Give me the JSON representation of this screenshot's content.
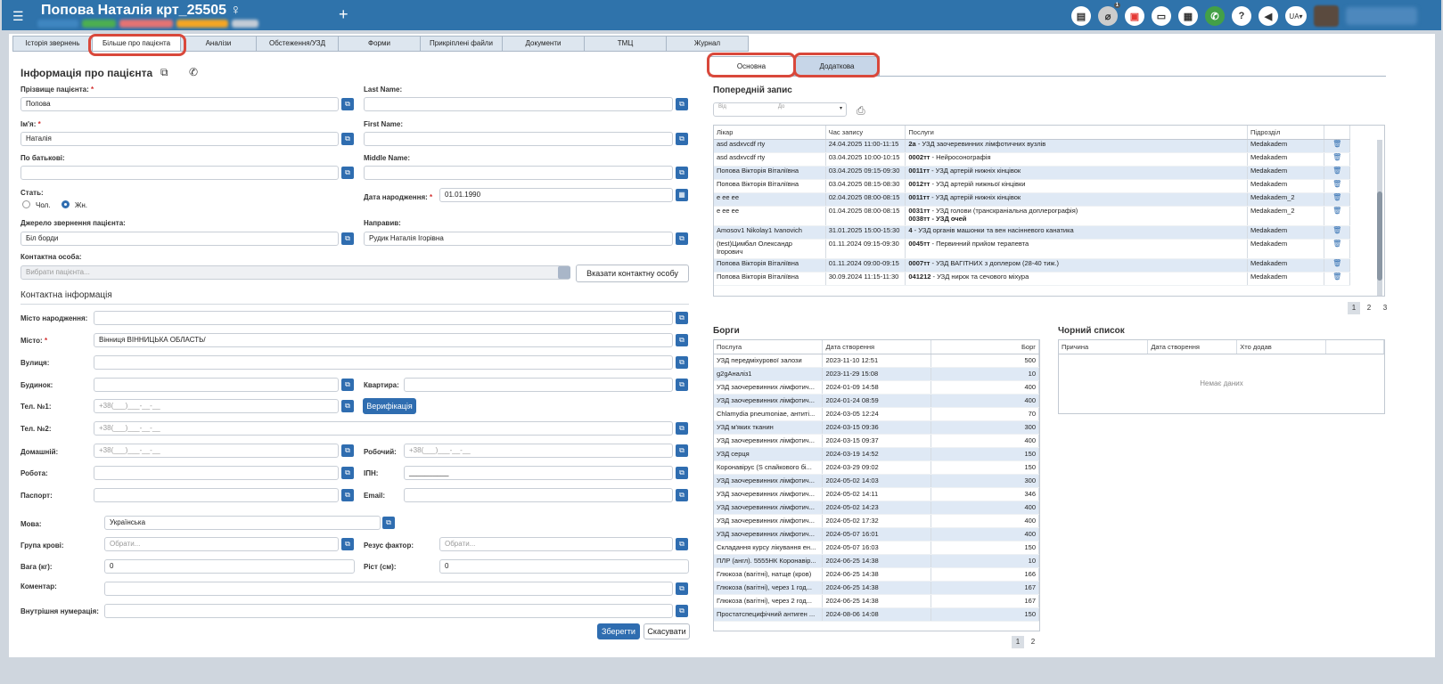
{
  "header": {
    "title": "Попова Наталія крт_25505 ♀",
    "menu_icon": "hamburger-icon",
    "plus": "+",
    "lang": "UA",
    "notification_count": "1",
    "icons": [
      "chat-icon",
      "paperclip-icon",
      "pdf-icon",
      "card-icon",
      "calculator-icon",
      "phone-icon",
      "help-icon",
      "megaphone-icon"
    ]
  },
  "tabs": [
    "Історія звернень",
    "Більше про пацієнта",
    "Аналізи",
    "Обстеження/УЗД",
    "Форми",
    "Прикріплені файли",
    "Документи",
    "ТМЦ",
    "Журнал"
  ],
  "patient": {
    "section_title": "Інформація про пацієнта",
    "surname_label": "Прізвище пацієнта:",
    "surname": "Попова",
    "lastname_label": "Last Name:",
    "lastname": "",
    "name_label": "Ім'я:",
    "name": "Наталія",
    "firstname_label": "First Name:",
    "firstname": "",
    "patronymic_label": "По батькові:",
    "patronymic": "",
    "middlename_label": "Middle Name:",
    "middlename": "",
    "sex_label": "Стать:",
    "sex_male": "Чол.",
    "sex_female": "Жн.",
    "dob_label": "Дата народження:",
    "dob": "01.01.1990",
    "source_label": "Джерело звернення пацієнта:",
    "source": "Біл борди",
    "referrer_label": "Направив:",
    "referrer": "Рудик Наталія Ігорівна",
    "contact_person_label": "Контактна особа:",
    "contact_person_placeholder": "Вибрати пацієнта...",
    "contact_person_button": "Вказати контактну особу"
  },
  "contact": {
    "section_title": "Контактна інформація",
    "birth_city_label": "Місто народження:",
    "birth_city": "",
    "city_label": "Місто:",
    "city": "Вінниця  ВІННИЦЬКА ОБЛАСТЬ/",
    "street_label": "Вулиця:",
    "street": "",
    "house_label": "Будинок:",
    "house": "",
    "apartment_label": "Квартира:",
    "apartment": "",
    "phone1_label": "Тел. №1:",
    "phone_placeholder": "+38(___)___-__-__",
    "verify_button": "Верифікація",
    "phone2_label": "Тел. №2:",
    "home_label": "Домашній:",
    "work_phone_label": "Робочий:",
    "job_label": "Робота:",
    "job": "",
    "ipn_label": "ІПН:",
    "ipn": "__________",
    "passport_label": "Паспорт:",
    "passport": "",
    "email_label": "Email:",
    "email": "",
    "language_label": "Мова:",
    "language": "Українська",
    "blood_label": "Група крові:",
    "blood_placeholder": "Обрати...",
    "rh_label": "Резус фактор:",
    "rh_placeholder": "Обрати...",
    "weight_label": "Вага (кг):",
    "weight": "0",
    "height_label": "Ріст (см):",
    "height": "0",
    "comment_label": "Коментар:",
    "comment": "",
    "internal_label": "Внутрішня нумерація:",
    "internal": "",
    "save_button": "Зберегти",
    "cancel_button": "Скасувати"
  },
  "right": {
    "subtabs": [
      "Основна",
      "Додаткова"
    ],
    "prev_title": "Попередній запис",
    "from_placeholder": "Від",
    "to_placeholder": "До",
    "appt_headers": [
      "Лікар",
      "Час запису",
      "Послуги",
      "Підрозділ"
    ],
    "appointments": [
      {
        "doctor": "asd asdxvcdf rty",
        "time": "24.04.2025 11:00-11:15",
        "code": "2а",
        "service": " - УЗД заочеревинних лімфотичних вузлів",
        "service2": "",
        "dept": "Medakadem"
      },
      {
        "doctor": "asd asdxvcdf rty",
        "time": "03.04.2025 10:00-10:15",
        "code": "0002тт",
        "service": " - Нейросонографія",
        "service2": "",
        "dept": "Medakadem"
      },
      {
        "doctor": "Попова Вікторія Віталіївна",
        "time": "03.04.2025 09:15-09:30",
        "code": "0011тт",
        "service": " - УЗД артерій нижніх кінцівок",
        "service2": "",
        "dept": "Medakadem"
      },
      {
        "doctor": "Попова Вікторія Віталіївна",
        "time": "03.04.2025 08:15-08:30",
        "code": "0012тт",
        "service": " - УЗД артерій нижньої кінцівки",
        "service2": "",
        "dept": "Medakadem"
      },
      {
        "doctor": "e ee ee",
        "time": "02.04.2025 08:00-08:15",
        "code": "0011тт",
        "service": " - УЗД артерій нижніх кінцівок",
        "service2": "",
        "dept": "Medakadem_2"
      },
      {
        "doctor": "e ee ee",
        "time": "01.04.2025 08:00-08:15",
        "code": "0031тт",
        "service": " - УЗД голови (транскраніальна доплерографія)",
        "service2": "0038тт - УЗД очей",
        "dept": "Medakadem_2"
      },
      {
        "doctor": "Amosov1 Nikolay1 Ivanovich",
        "time": "31.01.2025 15:00-15:30",
        "code": "4",
        "service": " - УЗД органів машонки та вен насінневого канатика",
        "service2": "",
        "dept": "Medakadem"
      },
      {
        "doctor": "(test)Цимбал Олександр",
        "time": "01.11.2024 09:15-09:30",
        "code": "0045тт",
        "service": " - Первинний прийом терапевта",
        "service2": "",
        "dept": "Medakadem",
        "doctor2": "Ігорович"
      },
      {
        "doctor": "Попова Вікторія Віталіївна",
        "time": "01.11.2024 09:00-09:15",
        "code": "0007тт",
        "service": " - УЗД ВАГІТНИХ з доплером (28-40 тиж.)",
        "service2": "",
        "dept": "Medakadem"
      },
      {
        "doctor": "Попова Вікторія Віталіївна",
        "time": "30.09.2024 11:15-11:30",
        "code": "041212",
        "service": " - УЗД нирок та сечового міхура",
        "service2": "",
        "dept": "Medakadem"
      }
    ],
    "appt_pages": [
      "1",
      "2",
      "3"
    ],
    "debts_title": "Борги",
    "debt_headers": [
      "Послуга",
      "Дата створення",
      "Борг"
    ],
    "debts": [
      [
        "УЗД передміхурової залози",
        "2023-11-10 12:51",
        "500"
      ],
      [
        "g2gАналіз1",
        "2023-11-29 15:08",
        "10"
      ],
      [
        "УЗД заочеревинних лімфотич...",
        "2024-01-09 14:58",
        "400"
      ],
      [
        "УЗД заочеревинних лімфотич...",
        "2024-01-24 08:59",
        "400"
      ],
      [
        "Chlamydia pneumoniae, антиті...",
        "2024-03-05 12:24",
        "70"
      ],
      [
        "УЗД м'яких тканин",
        "2024-03-15 09:36",
        "300"
      ],
      [
        "УЗД заочеревинних лімфотич...",
        "2024-03-15 09:37",
        "400"
      ],
      [
        "УЗД серця",
        "2024-03-19 14:52",
        "150"
      ],
      [
        "Коронавірус (S спайкового бі...",
        "2024-03-29 09:02",
        "150"
      ],
      [
        "УЗД заочеревинних лімфотич...",
        "2024-05-02 14:03",
        "300"
      ],
      [
        "УЗД заочеревинних лімфотич...",
        "2024-05-02 14:11",
        "346"
      ],
      [
        "УЗД заочеревинних лімфотич...",
        "2024-05-02 14:23",
        "400"
      ],
      [
        "УЗД заочеревинних лімфотич...",
        "2024-05-02 17:32",
        "400"
      ],
      [
        "УЗД заочеревинних лімфотич...",
        "2024-05-07 16:01",
        "400"
      ],
      [
        "Складання курсу лікування ен...",
        "2024-05-07 16:03",
        "150"
      ],
      [
        "ПЛР (англ). 5555НК Коронавір...",
        "2024-06-25 14:38",
        "10"
      ],
      [
        "Глюкоза (вагітні), натще (кров)",
        "2024-06-25 14:38",
        "166"
      ],
      [
        "Глюкоза (вагітні), через 1 год...",
        "2024-06-25 14:38",
        "167"
      ],
      [
        "Глюкоза (вагітні), через 2 год...",
        "2024-06-25 14:38",
        "167"
      ],
      [
        "Простатспецифічний антиген ...",
        "2024-08-06 14:08",
        "150"
      ]
    ],
    "debt_pages": [
      "1",
      "2"
    ],
    "blacklist_title": "Чорний список",
    "blacklist_headers": [
      "Причина",
      "Дата створення",
      "Хто додав"
    ],
    "no_data": "Немає даних"
  }
}
